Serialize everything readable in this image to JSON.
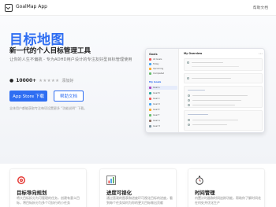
{
  "nav": {
    "brand": "GoalMap App",
    "help_label": "帮助文档"
  },
  "hero": {
    "title": "目标地图",
    "subtitle": "新一代的个人目标管理工具",
    "description": "让你的人生不偏航 - 专为ADHD用户设计的专注友好型目标管理使用",
    "rating_count": "10000+",
    "stars": "★★★★★",
    "rating_label": "添加好",
    "primary_button": "App Store 下载",
    "secondary_button": "帮助文档",
    "note": "全体用户都能获取专注每项设置更多 \"功能说明\" 下载。"
  },
  "mock": {
    "sidebar_title": "Goals",
    "sidebar_items": [
      "All Goals",
      "Today",
      "Upcoming",
      "Completed"
    ],
    "section_label": "My Goals",
    "goal_items": [
      "Goal A",
      "Goal B",
      "Goal C",
      "Goal D",
      "Goal E",
      "Goal F",
      "Goal G",
      "Goal H"
    ],
    "header": "My Overview",
    "dots": "•••"
  },
  "features": [
    {
      "icon": "target-icon",
      "title": "目标导向规划",
      "description": "将大目标拆分为可管理的任务，创建有意义目标，将目标拆分为多个可执行的小任务"
    },
    {
      "icon": "chart-icon",
      "title": "进度可视化",
      "description": "通过直观的图表和进度环可视化目标的进度，看到每个任务如何为你的更大目标做出贡献"
    },
    {
      "icon": "stopwatch-icon",
      "title": "时间管理",
      "description": "内置计时器和时间追踪功能，帮助你了解时间花在何处并优化生产"
    }
  ],
  "colors": {
    "accent": "#2f6ef2",
    "text_dark": "#1a1a1a",
    "text_muted": "#777777"
  }
}
